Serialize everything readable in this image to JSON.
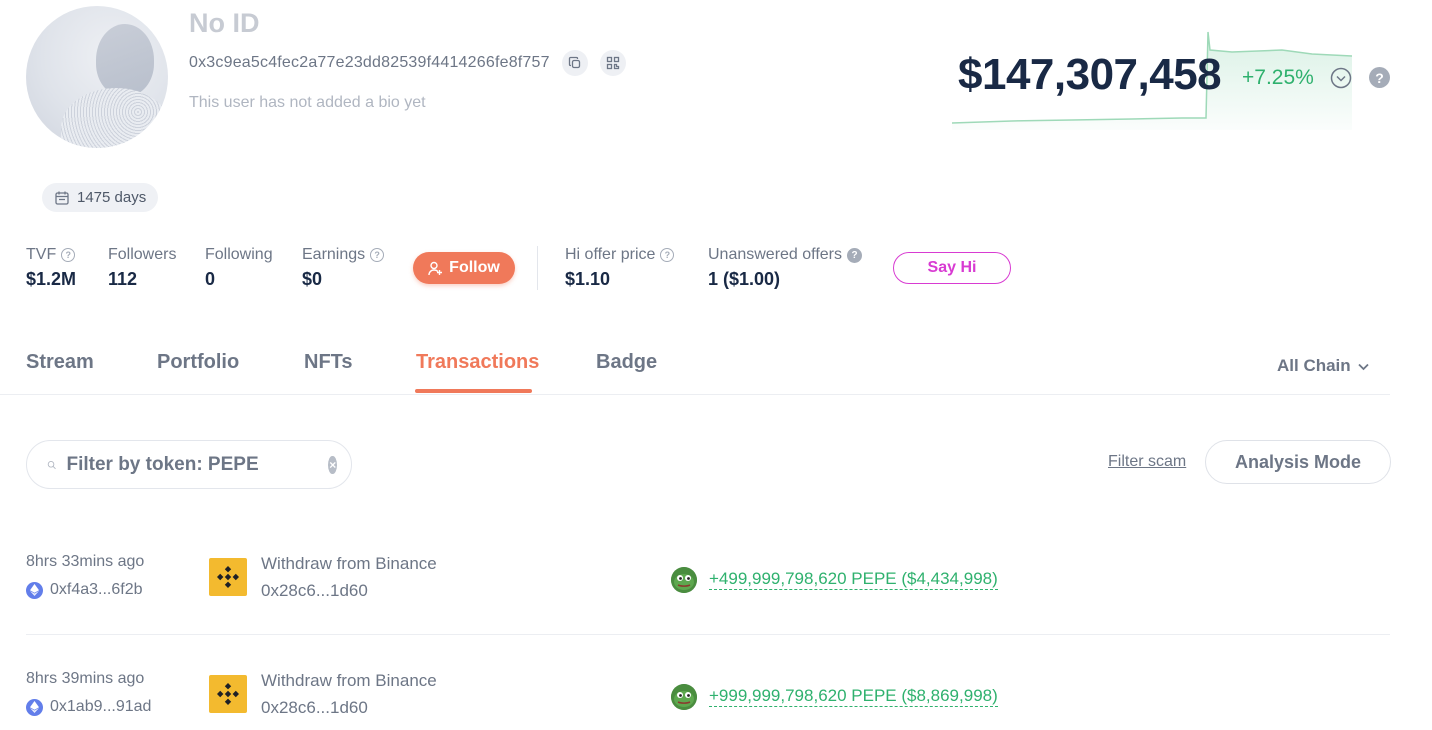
{
  "profile": {
    "name": "No ID",
    "address": "0x3c9ea5c4fec2a77e23dd82539f4414266fe8f757",
    "bio": "This user has not added a bio yet",
    "days": "1475 days"
  },
  "net_worth": {
    "value": "$147,307,458",
    "change": "+7.25%"
  },
  "stats": [
    {
      "label": "TVF",
      "value": "$1.2M"
    },
    {
      "label": "Followers",
      "value": "112"
    },
    {
      "label": "Following",
      "value": "0"
    },
    {
      "label": "Earnings",
      "value": "$0"
    },
    {
      "label": "Hi offer price",
      "value": "$1.10"
    },
    {
      "label": "Unanswered offers",
      "value": "1 ($1.00)"
    }
  ],
  "buttons": {
    "follow": "Follow",
    "say_hi": "Say Hi",
    "filter_scam": "Filter scam",
    "analysis_mode": "Analysis Mode"
  },
  "tabs": [
    "Stream",
    "Portfolio",
    "NFTs",
    "Transactions",
    "Badge"
  ],
  "active_tab": "Transactions",
  "chain_select": "All Chain",
  "filter": {
    "placeholder": "Filter by token: PEPE",
    "value": ""
  },
  "transactions": [
    {
      "time": "8hrs 33mins ago",
      "hash": "0xf4a3...6f2b",
      "type": "Withdraw from Binance",
      "counterparty": "0x28c6...1d60",
      "amount": "+499,999,798,620 PEPE ($4,434,998)"
    },
    {
      "time": "8hrs 39mins ago",
      "hash": "0x1ab9...91ad",
      "type": "Withdraw from Binance",
      "counterparty": "0x28c6...1d60",
      "amount": "+999,999,798,620 PEPE ($8,869,998)"
    }
  ],
  "colors": {
    "accent": "#f0795a",
    "positive": "#2fb16e",
    "say_hi": "#d83bd2",
    "text_primary": "#192945",
    "text_secondary": "#6d7686"
  },
  "icons": {
    "copy": "copy-icon",
    "qr": "qr-code-icon",
    "calendar": "calendar-icon",
    "chevron": "chevron-down-icon",
    "help": "help-icon",
    "search": "search-icon",
    "clear": "clear-icon",
    "ethereum": "ethereum-icon",
    "binance": "binance-logo-icon",
    "pepe": "pepe-token-icon"
  }
}
